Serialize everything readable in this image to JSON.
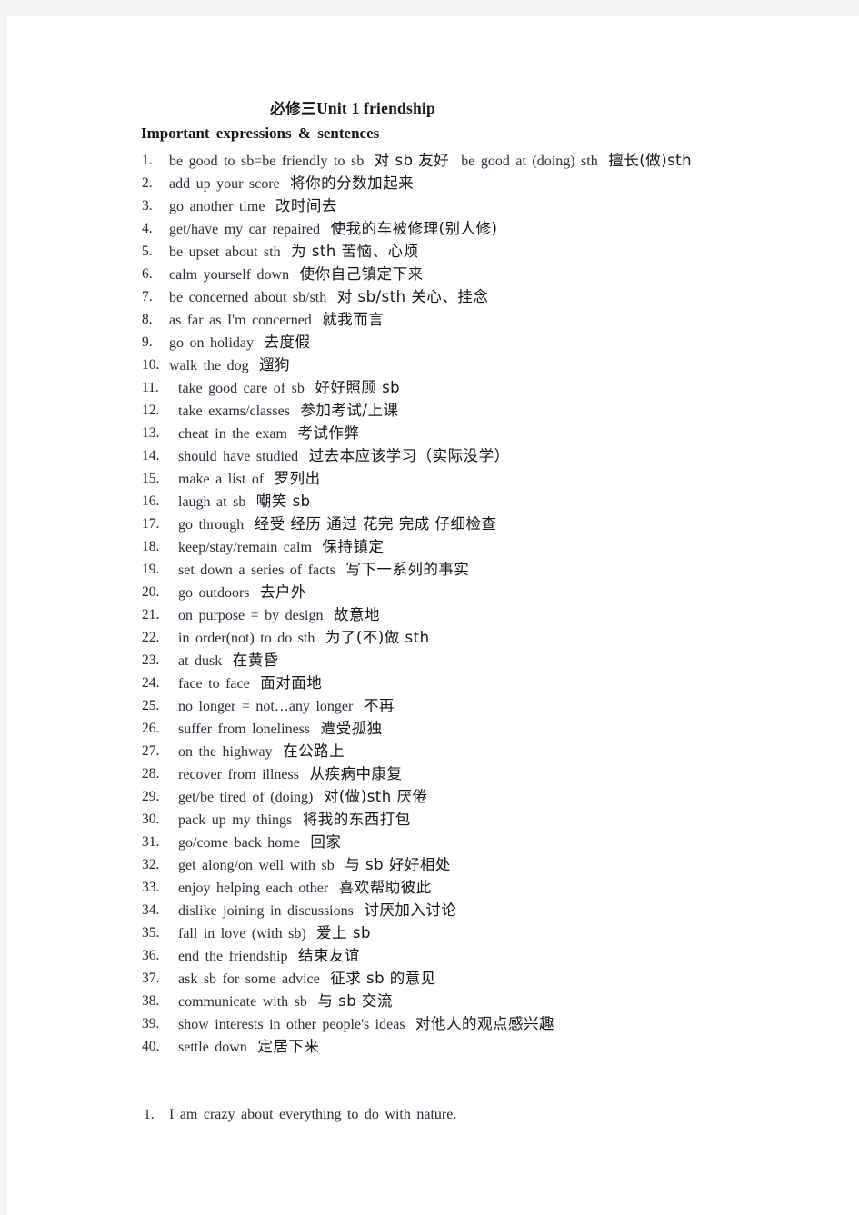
{
  "document": {
    "title_cn": "必修三",
    "title_en": "Unit 1 friendship",
    "section_heading": "Important  expressions  &  sentences"
  },
  "expressions": [
    {
      "n": "1.",
      "en": "be good to sb=be friendly to sb",
      "cn": "对 sb 友好",
      "en2": "be good at (doing) sth",
      "cn2": "擅长(做)sth"
    },
    {
      "n": "2.",
      "en": "add up your score",
      "cn": "将你的分数加起来"
    },
    {
      "n": "3.",
      "en": "go another time",
      "cn": "改时间去"
    },
    {
      "n": "4.",
      "en": "get/have my car repaired",
      "cn": "使我的车被修理(别人修)"
    },
    {
      "n": "5.",
      "en": "be upset about sth",
      "cn": "为 sth 苦恼、心烦"
    },
    {
      "n": "6.",
      "en": "calm yourself down",
      "cn": "使你自己镇定下来"
    },
    {
      "n": "7.",
      "en": "be concerned about sb/sth",
      "cn": "对 sb/sth 关心、挂念"
    },
    {
      "n": "8.",
      "en": "as far as I'm concerned",
      "cn": "就我而言"
    },
    {
      "n": "9.",
      "en": "go on holiday",
      "cn": "去度假"
    },
    {
      "n": "10.",
      "en": "walk the dog",
      "cn": "遛狗"
    },
    {
      "n": "11.",
      "en": "take good care of sb",
      "cn": "好好照顾 sb"
    },
    {
      "n": "12.",
      "en": "take exams/classes",
      "cn": "参加考试/上课"
    },
    {
      "n": "13.",
      "en": "cheat in the exam",
      "cn": "考试作弊"
    },
    {
      "n": "14.",
      "en": "should have studied",
      "cn": "过去本应该学习（实际没学）"
    },
    {
      "n": "15.",
      "en": "make a list of",
      "cn": "罗列出"
    },
    {
      "n": "16.",
      "en": "laugh at sb",
      "cn": "嘲笑 sb"
    },
    {
      "n": "17.",
      "en": "go through",
      "cn": "经受 经历 通过 花完 完成 仔细检查"
    },
    {
      "n": "18.",
      "en": "keep/stay/remain calm",
      "cn": "保持镇定"
    },
    {
      "n": "19.",
      "en": "set down a series of facts",
      "cn": "写下一系列的事实"
    },
    {
      "n": "20.",
      "en": "go outdoors",
      "cn": "去户外"
    },
    {
      "n": "21.",
      "en": "on purpose = by design",
      "cn": "故意地"
    },
    {
      "n": "22.",
      "en": "in order(not) to do sth",
      "cn": "为了(不)做 sth"
    },
    {
      "n": "23.",
      "en": "at dusk",
      "cn": "在黄昏"
    },
    {
      "n": "24.",
      "en": "face to face",
      "cn": "面对面地"
    },
    {
      "n": "25.",
      "en": "no longer = not…any longer",
      "cn": "不再"
    },
    {
      "n": "26.",
      "en": "suffer from loneliness",
      "cn": "遭受孤独"
    },
    {
      "n": "27.",
      "en": "on the highway",
      "cn": "在公路上"
    },
    {
      "n": "28.",
      "en": "recover from illness",
      "cn": "从疾病中康复"
    },
    {
      "n": "29.",
      "en": "get/be tired of (doing)",
      "cn": "对(做)sth 厌倦"
    },
    {
      "n": "30.",
      "en": "pack up my things",
      "cn": "将我的东西打包"
    },
    {
      "n": "31.",
      "en": "go/come back home",
      "cn": "回家"
    },
    {
      "n": "32.",
      "en": "get along/on well with sb",
      "cn": "与 sb 好好相处"
    },
    {
      "n": "33.",
      "en": "enjoy helping each other",
      "cn": "喜欢帮助彼此"
    },
    {
      "n": "34.",
      "en": "dislike joining in discussions",
      "cn": "讨厌加入讨论"
    },
    {
      "n": "35.",
      "en": "fall in love (with sb)",
      "cn": "爱上 sb"
    },
    {
      "n": "36.",
      "en": "end the friendship",
      "cn": "结束友谊"
    },
    {
      "n": "37.",
      "en": "ask sb for some advice",
      "cn": "征求 sb  的意见"
    },
    {
      "n": "38.",
      "en": "communicate with sb",
      "cn": "与 sb  交流"
    },
    {
      "n": "39.",
      "en": "show interests in other people's ideas",
      "cn": "对他人的观点感兴趣"
    },
    {
      "n": "40.",
      "en": "settle down",
      "cn": "定居下来"
    }
  ],
  "sentences": [
    {
      "n": "1.",
      "en": "I am crazy about everything to do with nature."
    }
  ]
}
